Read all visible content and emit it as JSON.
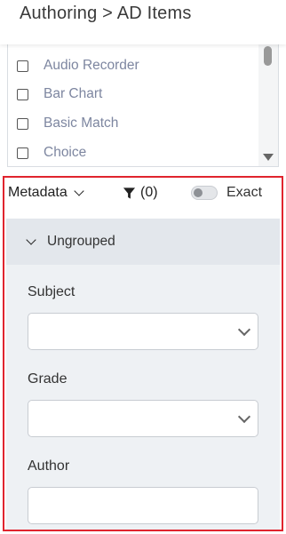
{
  "header": {
    "breadcrumb": "Authoring > AD Items"
  },
  "item_list": {
    "items": [
      {
        "label": "Audio Recorder",
        "checked": false
      },
      {
        "label": "Bar Chart",
        "checked": false
      },
      {
        "label": "Basic Match",
        "checked": false
      },
      {
        "label": "Choice",
        "checked": false
      }
    ]
  },
  "metadata_panel": {
    "dropdown_label": "Metadata",
    "filter_count": "(0)",
    "exact_label": "Exact",
    "exact_enabled": false,
    "group": {
      "label": "Ungrouped",
      "fields": [
        {
          "label": "Subject",
          "type": "select",
          "value": ""
        },
        {
          "label": "Grade",
          "type": "select",
          "value": ""
        },
        {
          "label": "Author",
          "type": "text",
          "value": ""
        }
      ]
    }
  },
  "colors": {
    "highlight_border": "#e0242e",
    "list_text": "#7d86a0",
    "group_bg": "#eef1f4"
  }
}
